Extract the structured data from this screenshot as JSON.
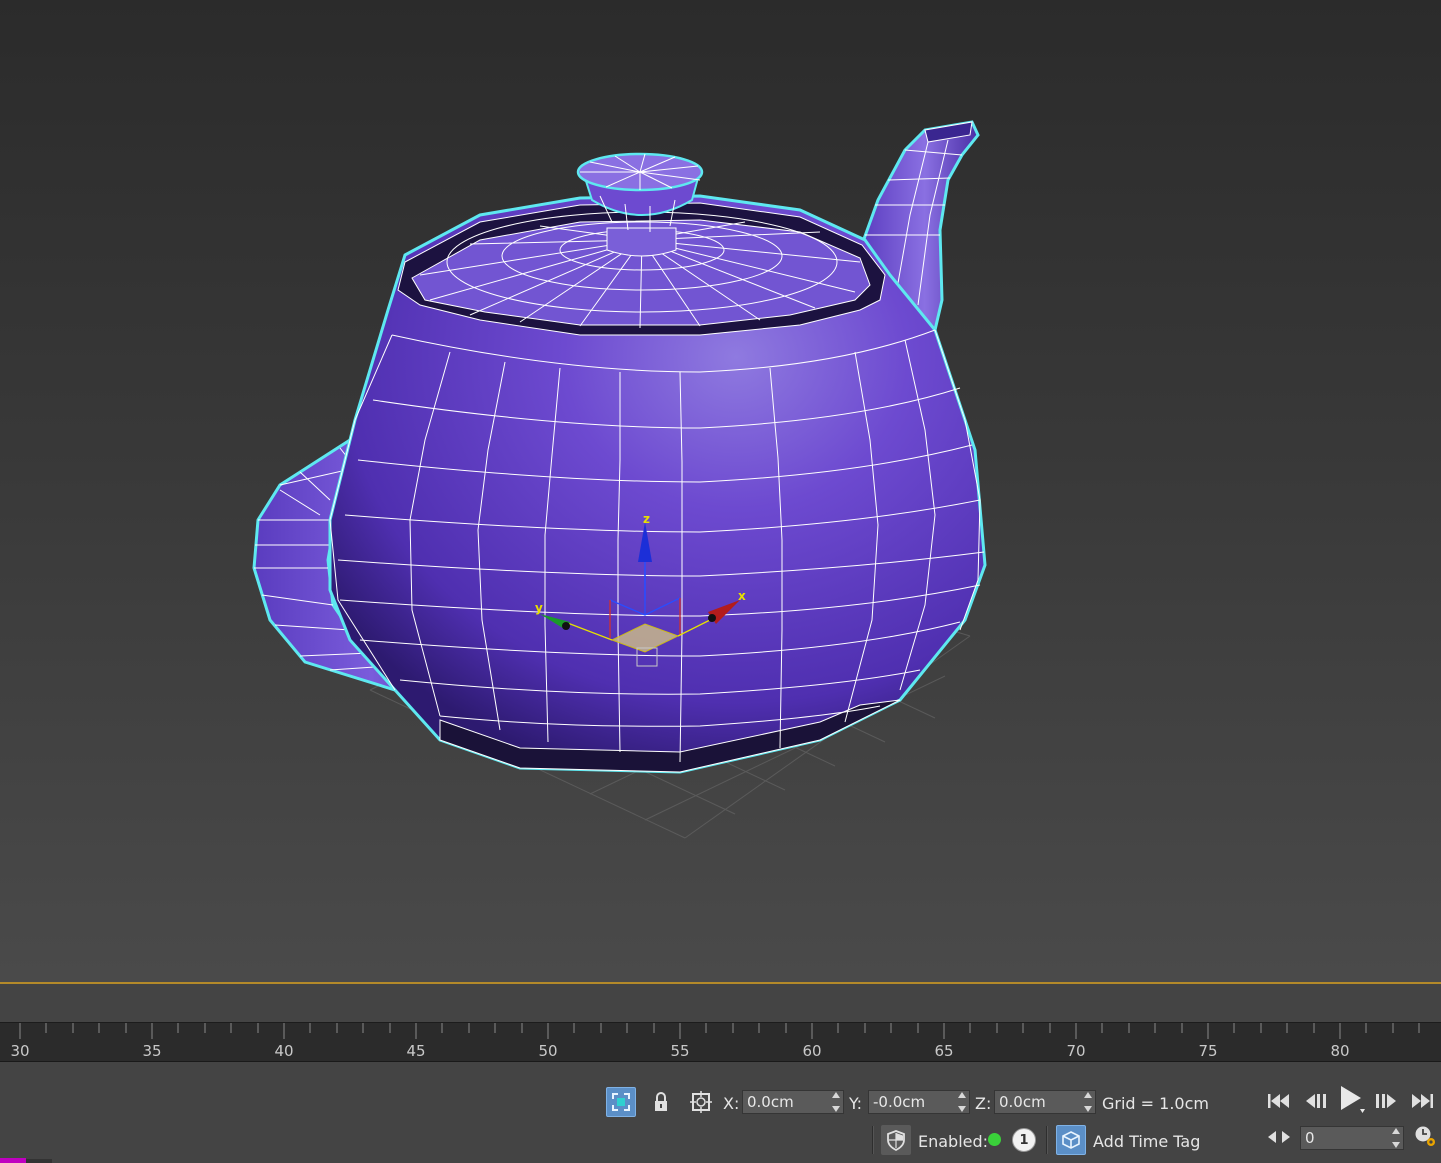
{
  "viewport": {
    "selection_color": "#5ee8f0",
    "object_color": "#6a44c8",
    "gizmo": {
      "x_label": "x",
      "y_label": "y",
      "z_label": "z"
    }
  },
  "timeline": {
    "ticks": [
      "30",
      "35",
      "40",
      "45",
      "50",
      "55",
      "60",
      "65",
      "70",
      "75",
      "80"
    ]
  },
  "statusbar": {
    "selection_icon": "selection-lock-icon",
    "x_label": "X:",
    "x_value": "0.0cm",
    "y_label": "Y:",
    "y_value": "-0.0cm",
    "z_label": "Z:",
    "z_value": "0.0cm",
    "grid_text": "Grid = 1.0cm",
    "enabled_label": "Enabled:",
    "badge_value": "1",
    "add_time_tag": "Add Time Tag",
    "frame_value": "0"
  }
}
